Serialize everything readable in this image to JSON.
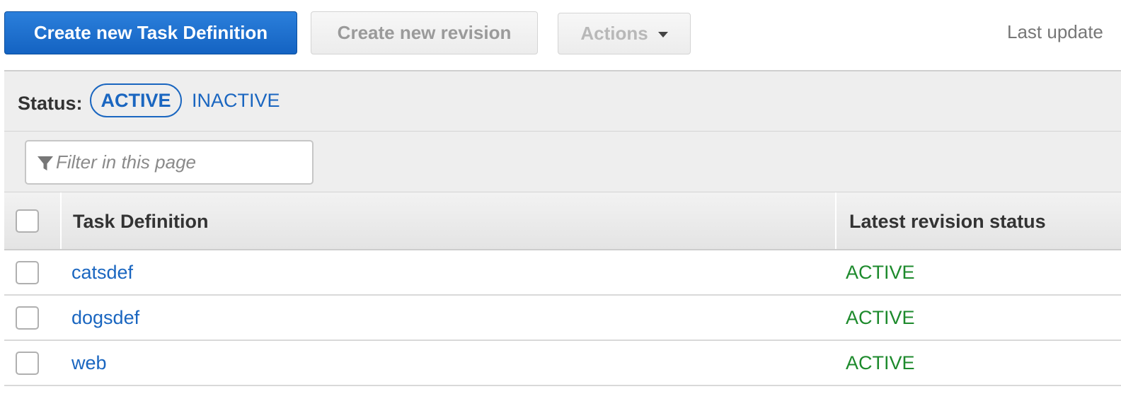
{
  "toolbar": {
    "create_task_definition_label": "Create new Task Definition",
    "create_revision_label": "Create new revision",
    "actions_label": "Actions",
    "last_updated_text": "Last update"
  },
  "status_filter": {
    "label": "Status:",
    "options": [
      {
        "label": "ACTIVE",
        "selected": true
      },
      {
        "label": "INACTIVE",
        "selected": false
      }
    ]
  },
  "filter": {
    "placeholder": "Filter in this page",
    "value": "",
    "icon": "filter-icon"
  },
  "table": {
    "columns": [
      "Task Definition",
      "Latest revision status"
    ],
    "rows": [
      {
        "name": "catsdef",
        "status": "ACTIVE"
      },
      {
        "name": "dogsdef",
        "status": "ACTIVE"
      },
      {
        "name": "web",
        "status": "ACTIVE"
      }
    ]
  },
  "colors": {
    "primary": "#1a66c0",
    "status_active": "#1d8a2c",
    "disabled_text": "#9a9a9a"
  }
}
